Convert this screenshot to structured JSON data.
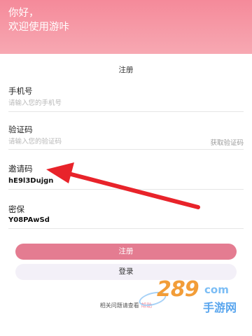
{
  "header": {
    "greeting_line1": "你好，",
    "greeting_line2": "欢迎使用游咔"
  },
  "page_title": "注册",
  "form": {
    "phone": {
      "label": "手机号",
      "placeholder": "请输入您的手机号",
      "value": ""
    },
    "code": {
      "label": "验证码",
      "placeholder": "请输入您的验证码",
      "value": "",
      "action_label": "获取验证码"
    },
    "invite": {
      "label": "邀请码",
      "value": "hE9l3Dujgn"
    },
    "security": {
      "label": "密保",
      "value": "Y08PAwSd"
    }
  },
  "buttons": {
    "register_label": "注册",
    "login_label": "登录"
  },
  "help": {
    "text": "相关问题请查看",
    "link_text": "帮助"
  },
  "watermark": {
    "number": "289",
    "suffix": "com",
    "sub_text": "手游网"
  },
  "colors": {
    "header_pink": "#f58a9a",
    "register_button": "#e47c91",
    "login_button": "#f3f0f8",
    "arrow_red": "#e8232a",
    "watermark_orange": "#f29d38",
    "watermark_blue": "#5aa6ee"
  }
}
